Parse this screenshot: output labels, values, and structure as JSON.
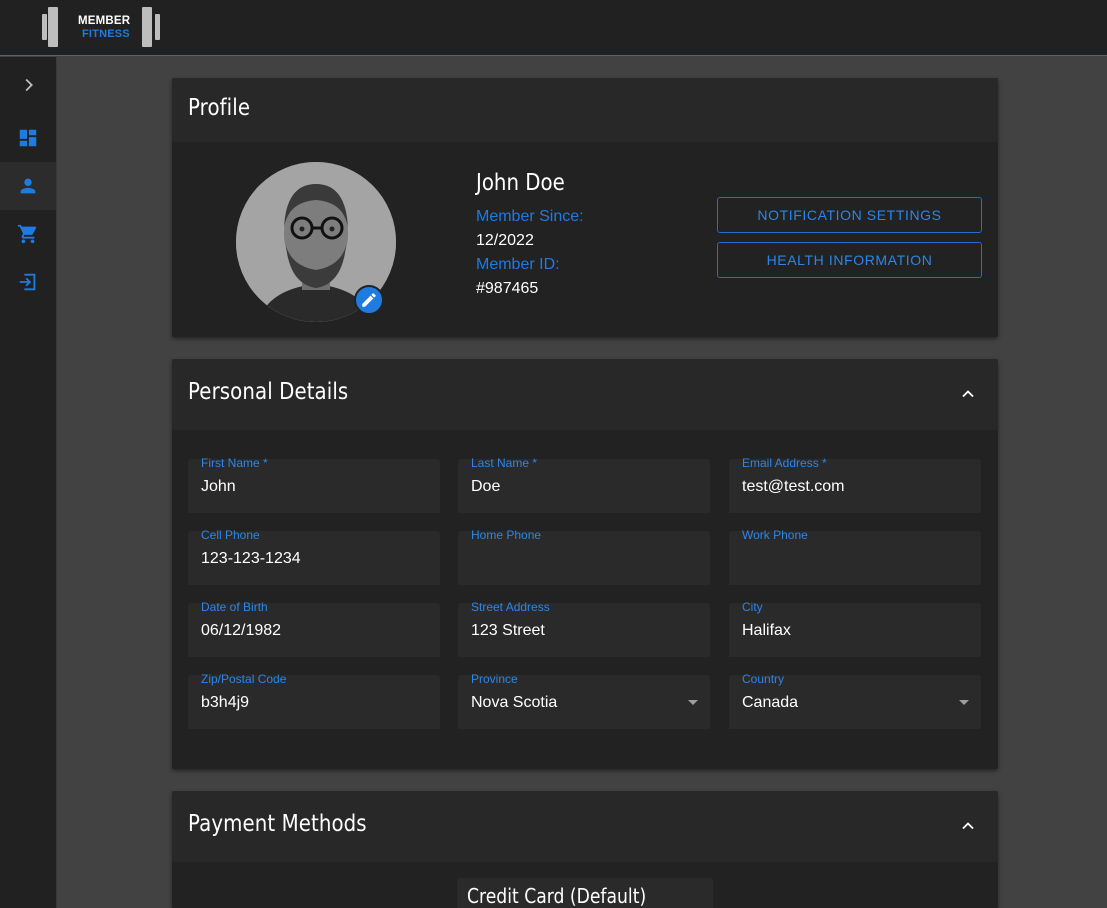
{
  "brand": {
    "line1": "MEMBER",
    "line2": "FITNESS"
  },
  "sidebar": {
    "items": [
      {
        "name": "expand",
        "icon": "chevron-right-icon"
      },
      {
        "name": "dashboard",
        "icon": "dashboard-icon"
      },
      {
        "name": "profile",
        "icon": "person-icon"
      },
      {
        "name": "shop",
        "icon": "cart-icon"
      },
      {
        "name": "logout",
        "icon": "logout-icon"
      }
    ]
  },
  "profile": {
    "title": "Profile",
    "name": "John Doe",
    "member_since_label": "Member Since:",
    "member_since": "12/2022",
    "member_id_label": "Member ID:",
    "member_id": "#987465",
    "notification_button": "NOTIFICATION SETTINGS",
    "health_button": "HEALTH INFORMATION"
  },
  "personal": {
    "title": "Personal Details",
    "fields": {
      "first_name": {
        "label": "First Name *",
        "value": "John"
      },
      "last_name": {
        "label": "Last Name *",
        "value": "Doe"
      },
      "email": {
        "label": "Email Address *",
        "value": "test@test.com"
      },
      "cell_phone": {
        "label": "Cell Phone",
        "value": "123-123-1234"
      },
      "home_phone": {
        "label": "Home Phone",
        "value": ""
      },
      "work_phone": {
        "label": "Work Phone",
        "value": ""
      },
      "dob": {
        "label": "Date of Birth",
        "value": "06/12/1982"
      },
      "street": {
        "label": "Street Address",
        "value": "123 Street"
      },
      "city": {
        "label": "City",
        "value": "Halifax"
      },
      "zip": {
        "label": "Zip/Postal Code",
        "value": "b3h4j9"
      },
      "province": {
        "label": "Province",
        "value": "Nova Scotia"
      },
      "country": {
        "label": "Country",
        "value": "Canada"
      }
    }
  },
  "payment": {
    "title": "Payment Methods",
    "card_title": "Credit Card (Default)"
  },
  "colors": {
    "accent": "#1e7be0",
    "background": "#424242",
    "surface": "#252525"
  }
}
